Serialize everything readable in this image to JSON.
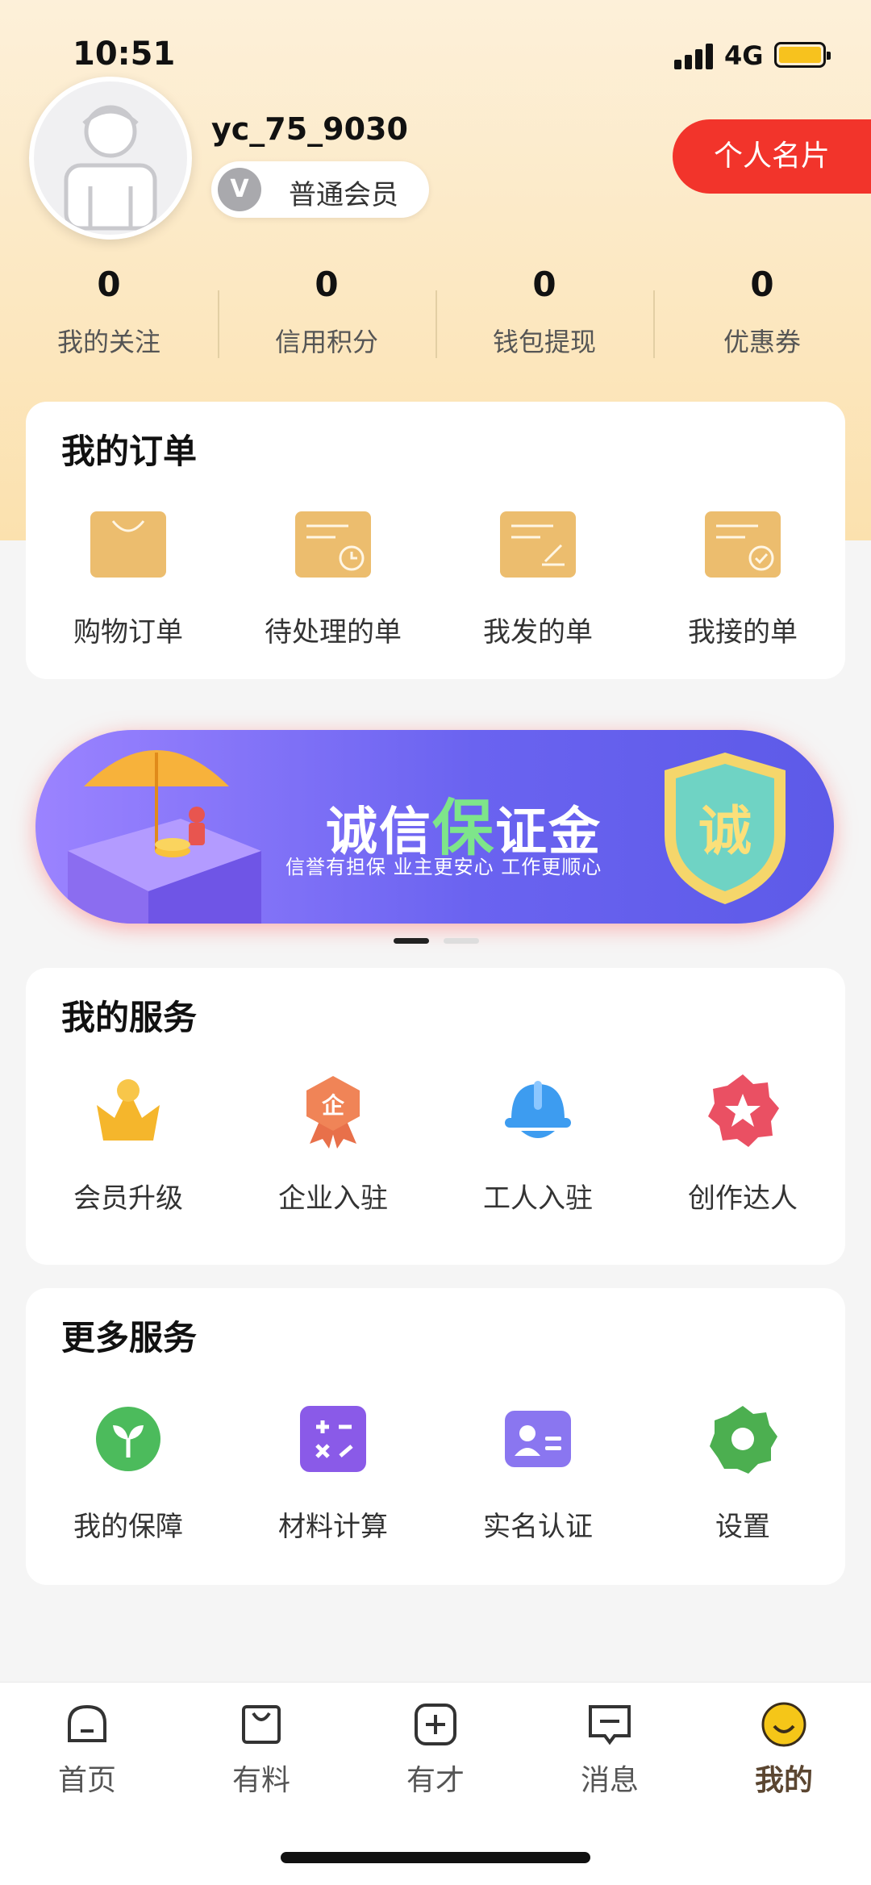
{
  "status": {
    "time": "10:51",
    "network": "4G"
  },
  "profile": {
    "username": "yc_75_9030",
    "member_level": "普通会员",
    "card_button": "个人名片"
  },
  "stats": [
    {
      "value": "0",
      "label": "我的关注"
    },
    {
      "value": "0",
      "label": "信用积分"
    },
    {
      "value": "0",
      "label": "钱包提现"
    },
    {
      "value": "0",
      "label": "优惠券"
    }
  ],
  "orders": {
    "title": "我的订单",
    "items": [
      {
        "label": "购物订单",
        "icon": "shopping-bag-icon"
      },
      {
        "label": "待处理的单",
        "icon": "pending-order-icon"
      },
      {
        "label": "我发的单",
        "icon": "sent-order-icon"
      },
      {
        "label": "我接的单",
        "icon": "received-order-icon"
      }
    ]
  },
  "banner": {
    "title_prefix": "诚信",
    "title_highlight": "保",
    "title_suffix": "证金",
    "subtitle": "信誉有担保  业主更安心  工作更顺心",
    "badge": "诚",
    "colors": {
      "start": "#9b83ff",
      "end": "#5d5ae8"
    }
  },
  "services": {
    "title": "我的服务",
    "items": [
      {
        "label": "会员升级",
        "icon": "crown-icon"
      },
      {
        "label": "企业入驻",
        "icon": "enterprise-badge-icon",
        "icon_text": "企"
      },
      {
        "label": "工人入驻",
        "icon": "hard-hat-icon"
      },
      {
        "label": "创作达人",
        "icon": "star-badge-icon"
      }
    ]
  },
  "more_services": {
    "title": "更多服务",
    "items": [
      {
        "label": "我的保障",
        "icon": "sprout-icon"
      },
      {
        "label": "材料计算",
        "icon": "calculator-icon"
      },
      {
        "label": "实名认证",
        "icon": "id-card-icon"
      },
      {
        "label": "设置",
        "icon": "settings-gear-icon"
      }
    ]
  },
  "tabbar": {
    "items": [
      {
        "label": "首页",
        "icon": "home-icon"
      },
      {
        "label": "有料",
        "icon": "bag-icon"
      },
      {
        "label": "有才",
        "icon": "plus-square-icon"
      },
      {
        "label": "消息",
        "icon": "message-icon"
      },
      {
        "label": "我的",
        "icon": "smiley-icon",
        "active": true
      }
    ]
  },
  "theme": {
    "accent": "#f2342b",
    "gold": "#e6b05a",
    "active_tab": "#5b4631"
  }
}
